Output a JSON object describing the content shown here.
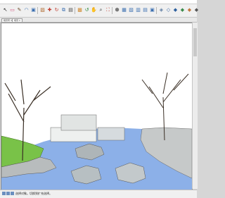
{
  "window": {
    "title": ""
  },
  "toolbar": {
    "buttons": [
      {
        "name": "select-tool-icon",
        "glyph": "↖",
        "color": "#222222"
      },
      {
        "name": "eraser-tool-icon",
        "glyph": "▭",
        "color": "#d04b78"
      },
      {
        "name": "pencil-tool-icon",
        "glyph": "✎",
        "color": "#6a4a2a"
      },
      {
        "name": "arc-tool-icon",
        "glyph": "◠",
        "color": "#3b6fb0"
      },
      {
        "name": "shape-tool-icon",
        "glyph": "▣",
        "color": "#3b6fb0"
      },
      {
        "name": "push-pull-tool-icon",
        "glyph": "▨",
        "color": "#b06a30"
      },
      {
        "name": "move-tool-icon",
        "glyph": "✚",
        "color": "#c0392b"
      },
      {
        "name": "rotate-tool-icon",
        "glyph": "↻",
        "color": "#c0392b"
      },
      {
        "name": "offset-tool-icon",
        "glyph": "⧉",
        "color": "#3b6fb0"
      },
      {
        "name": "tape-measure-tool-icon",
        "glyph": "▤",
        "color": "#444444"
      },
      {
        "name": "paint-bucket-tool-icon",
        "glyph": "▩",
        "color": "#d08a30"
      },
      {
        "name": "orbit-tool-icon",
        "glyph": "↺",
        "color": "#2c8a3a"
      },
      {
        "name": "pan-tool-icon",
        "glyph": "✋",
        "color": "#c07a40"
      },
      {
        "name": "zoom-tool-icon",
        "glyph": "⌕",
        "color": "#333333"
      },
      {
        "name": "zoom-extents-icon",
        "glyph": "⛶",
        "color": "#c0392b"
      },
      {
        "name": "iso-view-icon",
        "glyph": "⬢",
        "color": "#7a7a7a"
      },
      {
        "name": "top-view-icon",
        "glyph": "▦",
        "color": "#3b6fb0"
      },
      {
        "name": "front-view-icon",
        "glyph": "▧",
        "color": "#3b6fb0"
      },
      {
        "name": "right-view-icon",
        "glyph": "▥",
        "color": "#3b6fb0"
      },
      {
        "name": "back-view-icon",
        "glyph": "▤",
        "color": "#3b6fb0"
      },
      {
        "name": "left-view-icon",
        "glyph": "▣",
        "color": "#3b6fb0"
      },
      {
        "name": "xray-style-icon",
        "glyph": "◈",
        "color": "#5a7aa0"
      },
      {
        "name": "wireframe-style-icon",
        "glyph": "◇",
        "color": "#2c5f9e"
      },
      {
        "name": "hidden-line-style-icon",
        "glyph": "◆",
        "color": "#2c5f9e"
      },
      {
        "name": "shaded-style-icon",
        "glyph": "◆",
        "color": "#3a8a4a"
      },
      {
        "name": "textured-style-icon",
        "glyph": "◆",
        "color": "#c07a40"
      },
      {
        "name": "monochrome-style-icon",
        "glyph": "◆",
        "color": "#555555"
      }
    ]
  },
  "scene_tabs": [
    {
      "label": "场景号 3"
    },
    {
      "label": "场景 1"
    }
  ],
  "status": {
    "text": "选择对象。切换到扩充选择。"
  },
  "colors": {
    "sky": "#ffffff",
    "water": "#8cb0e8",
    "grass": "#79c248",
    "rock": "#aeb5b8",
    "tree": "#3a2f25"
  }
}
